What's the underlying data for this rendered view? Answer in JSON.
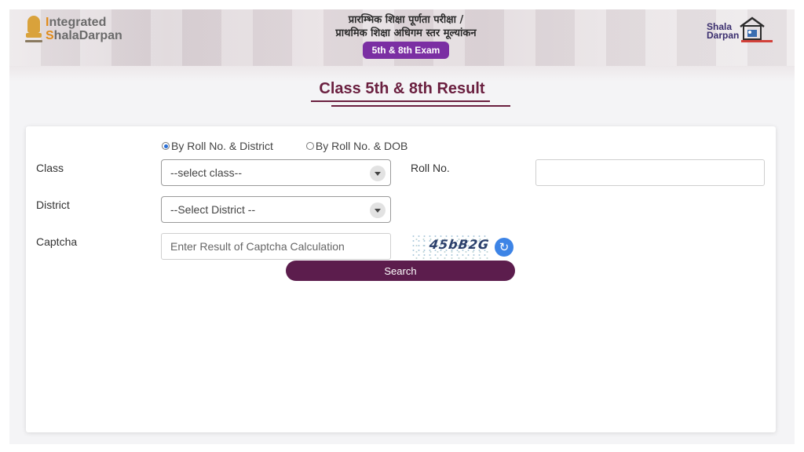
{
  "header": {
    "brand_left_line1_first": "I",
    "brand_left_line1_rest": "ntegrated",
    "brand_left_line2_first": "S",
    "brand_left_line2_rest": "halaDarpan",
    "title_hindi_line1": "प्रारम्भिक शिक्षा पूर्णता परीक्षा /",
    "title_hindi_line2": "प्राथमिक शिक्षा अधिगम स्तर मूल्यांकन",
    "exam_badge": "5th & 8th Exam",
    "brand_right_line1": "Shala",
    "brand_right_line2": "Darpan"
  },
  "page_title": "Class 5th & 8th Result",
  "form": {
    "radio_options": [
      {
        "label": "By Roll No. & District",
        "selected": true
      },
      {
        "label": "By Roll No. & DOB",
        "selected": false
      }
    ],
    "class_label": "Class",
    "class_select_value": "--select class--",
    "roll_label": "Roll No.",
    "roll_value": "",
    "district_label": "District",
    "district_select_value": "--Select District --",
    "captcha_label": "Captcha",
    "captcha_placeholder": "Enter Result of Captcha Calculation",
    "captcha_code": "45bB2G",
    "search_button": "Search"
  },
  "colors": {
    "brand_purple": "#5c1d4d",
    "heading": "#6a1f3f",
    "badge": "#7b2fa3",
    "refresh": "#3d84e6"
  }
}
